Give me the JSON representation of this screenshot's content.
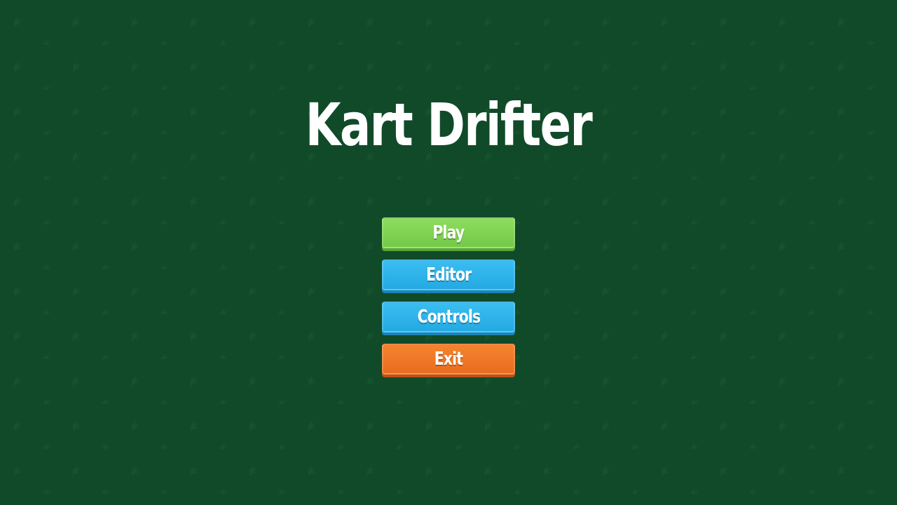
{
  "game": {
    "title": "Kart Drifter"
  },
  "menu": {
    "play_label": "Play",
    "editor_label": "Editor",
    "controls_label": "Controls",
    "exit_label": "Exit"
  },
  "colors": {
    "background": "#114a28",
    "play": "#7dcf50",
    "editor": "#2db3ea",
    "controls": "#2db3ea",
    "exit": "#ef772a",
    "text": "#ffffff"
  },
  "background_icon": "leaf-pattern-icon"
}
